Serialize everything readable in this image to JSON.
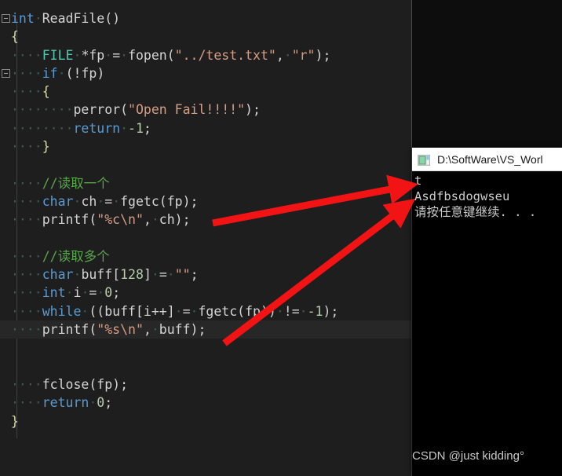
{
  "editor": {
    "theme_background": "#1e1e1e",
    "current_line_background": "#272727",
    "lines": [
      {
        "id": 1,
        "text": "int ReadFile()",
        "fold": true
      },
      {
        "id": 2,
        "text": "{",
        "fold": false
      },
      {
        "id": 3,
        "text": "    FILE *fp = fopen(\"../test.txt\", \"r\");",
        "fold": false
      },
      {
        "id": 4,
        "text": "    if (!fp)",
        "fold": true
      },
      {
        "id": 5,
        "text": "    {",
        "fold": false
      },
      {
        "id": 6,
        "text": "        perror(\"Open Fail!!!!\");",
        "fold": false
      },
      {
        "id": 7,
        "text": "        return -1;",
        "fold": false
      },
      {
        "id": 8,
        "text": "    }",
        "fold": false
      },
      {
        "id": 9,
        "text": "",
        "fold": false
      },
      {
        "id": 10,
        "text": "    //读取一个",
        "fold": false
      },
      {
        "id": 11,
        "text": "    char ch = fgetc(fp);",
        "fold": false
      },
      {
        "id": 12,
        "text": "    printf(\"%c\\n\", ch);",
        "fold": false
      },
      {
        "id": 13,
        "text": "",
        "fold": false
      },
      {
        "id": 14,
        "text": "    //读取多个",
        "fold": false
      },
      {
        "id": 15,
        "text": "    char buff[128] = \"\";",
        "fold": false
      },
      {
        "id": 16,
        "text": "    int i = 0;",
        "fold": false
      },
      {
        "id": 17,
        "text": "    while ((buff[i++] = fgetc(fp)) != -1);",
        "fold": false
      },
      {
        "id": 18,
        "text": "    printf(\"%s\\n\", buff);",
        "fold": false,
        "current": true
      },
      {
        "id": 19,
        "text": "",
        "fold": false
      },
      {
        "id": 20,
        "text": "",
        "fold": false
      },
      {
        "id": 21,
        "text": "    fclose(fp);",
        "fold": false
      },
      {
        "id": 22,
        "text": "    return 0;",
        "fold": false
      },
      {
        "id": 23,
        "text": "}",
        "fold": false
      }
    ]
  },
  "console": {
    "title": "D:\\SoftWare\\VS_Worl",
    "icon": "console-window-icon",
    "output": [
      "t",
      "Asdfbsdogwseu",
      "请按任意键继续. . ."
    ]
  },
  "annotations": {
    "arrow_color": "#f21414",
    "arrows": [
      {
        "name": "arrow-char-output",
        "from": "printf(\"%c\\n\", ch);",
        "to": "t"
      },
      {
        "name": "arrow-string-output",
        "from": "printf(\"%s\\n\", buff);",
        "to": "Asdfbsdogwseu"
      }
    ]
  },
  "watermark": {
    "text": "CSDN @just kidding°"
  }
}
